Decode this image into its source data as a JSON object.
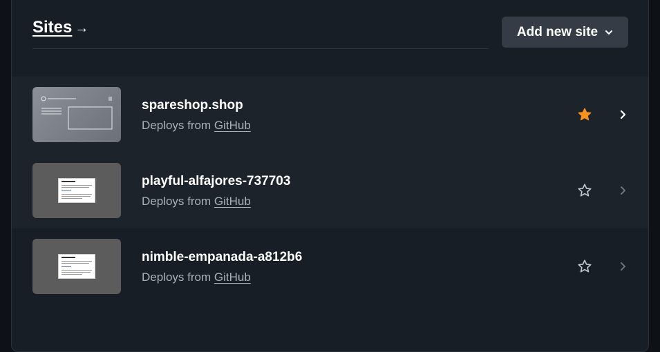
{
  "header": {
    "title": "Sites",
    "title_arrow": "→",
    "add_button_label": "Add new site"
  },
  "sites": [
    {
      "name": "spareshop.shop",
      "deploy_prefix": "Deploys from ",
      "deploy_source": "GitHub",
      "favorited": true
    },
    {
      "name": "playful-alfajores-737703",
      "deploy_prefix": "Deploys from ",
      "deploy_source": "GitHub",
      "favorited": false
    },
    {
      "name": "nimble-empanada-a812b6",
      "deploy_prefix": "Deploys from ",
      "deploy_source": "GitHub",
      "favorited": false
    }
  ],
  "colors": {
    "star_active": "#f7931e",
    "star_inactive": "#c3c9d1",
    "chevron_active": "#ffffff",
    "chevron_inactive": "#6b737d"
  },
  "icons": {
    "arrow": "arrow-right-icon",
    "dropdown": "chevron-down-icon",
    "favorite": "star-icon",
    "open": "chevron-right-icon"
  }
}
